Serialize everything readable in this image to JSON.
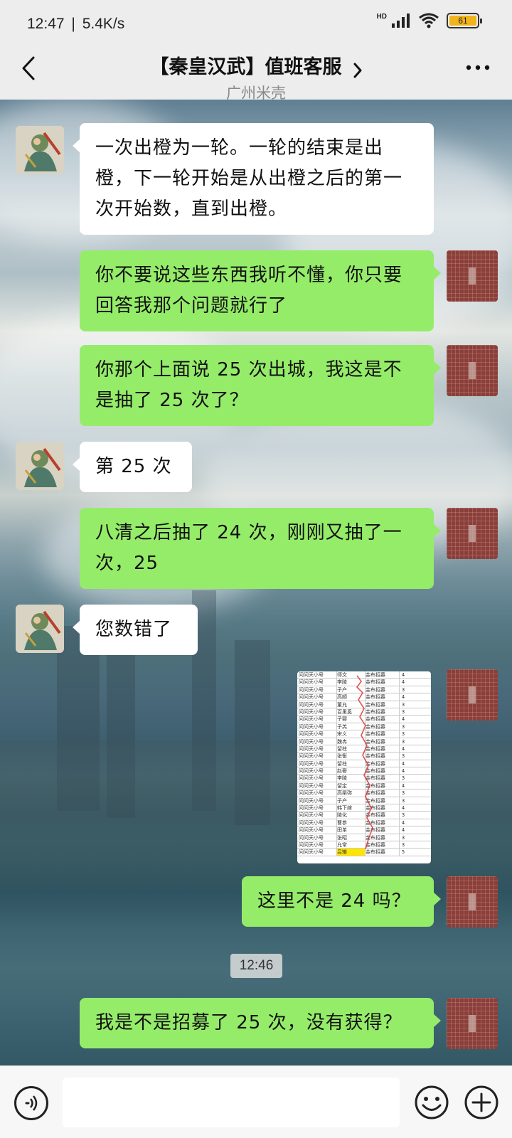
{
  "status_bar": {
    "time": "12:47",
    "speed": "5.4K/s",
    "hd_label": "HD",
    "battery": "61"
  },
  "header": {
    "title": "【秦皇汉武】值班客服",
    "subtitle": "广州米壳",
    "back_icon": "chevron-left-icon",
    "more_icon": "more-dots-icon"
  },
  "messages": [
    {
      "side": "left",
      "text": "一次出橙为一轮。一轮的结束是出橙，下一轮开始是从出橙之后的第一次开始数，直到出橙。"
    },
    {
      "side": "right",
      "text": "你不要说这些东西我听不懂，你只要回答我那个问题就行了"
    },
    {
      "side": "right",
      "text": "你那个上面说 25 次出城，我这是不是抽了 25 次了？"
    },
    {
      "side": "left",
      "text": "第 25 次"
    },
    {
      "side": "right",
      "text": "八清之后抽了 24 次，刚刚又抽了一次，25"
    },
    {
      "side": "left",
      "text": "您数错了"
    },
    {
      "side": "right",
      "type": "image",
      "alt": "recruit-log-screenshot"
    },
    {
      "side": "right",
      "text": "这里不是 24 吗？"
    },
    {
      "side": "right",
      "text": "我是不是招募了 25 次，没有获得？"
    }
  ],
  "timestamp_chip": "12:46",
  "image_table": {
    "rows": [
      [
        "问问天小号",
        "师文",
        "金布招募",
        "4"
      ],
      [
        "问问天小号",
        "李陵",
        "金布招募",
        "4"
      ],
      [
        "问问天小号",
        "子产",
        "金布招募",
        "3"
      ],
      [
        "问问天小号",
        "高顺",
        "金布招募",
        "4"
      ],
      [
        "问问天小号",
        "董允",
        "金布招募",
        "3"
      ],
      [
        "问问天小号",
        "百里奚",
        "金布招募",
        "3"
      ],
      [
        "问问天小号",
        "子婴",
        "金布招募",
        "4"
      ],
      [
        "问问天小号",
        "子羔",
        "金布招募",
        "3"
      ],
      [
        "问问天小号",
        "宋义",
        "金布招募",
        "3"
      ],
      [
        "问问天小号",
        "魏冉",
        "金布招募",
        "3"
      ],
      [
        "问问天小号",
        "留柱",
        "金布招募",
        "4"
      ],
      [
        "问问天小号",
        "张衡",
        "金布招募",
        "3"
      ],
      [
        "问问天小号",
        "留柱",
        "金布招募",
        "4"
      ],
      [
        "问问天小号",
        "赵奢",
        "金布招募",
        "4"
      ],
      [
        "问问天小号",
        "李陵",
        "金布招募",
        "3"
      ],
      [
        "问问天小号",
        "留定",
        "金布招募",
        "4"
      ],
      [
        "问问天小号",
        "高渠弥",
        "金布招募",
        "3"
      ],
      [
        "问问天小号",
        "子产",
        "金布招募",
        "3"
      ],
      [
        "问问天小号",
        "韩下嫁",
        "金布招募",
        "4"
      ],
      [
        "问问天小号",
        "陵化",
        "金布招募",
        "3"
      ],
      [
        "问问天小号",
        "曹参",
        "金布招募",
        "4"
      ],
      [
        "问问天小号",
        "田单",
        "金布招募",
        "4"
      ],
      [
        "问问天小号",
        "张昭",
        "金布招募",
        "3"
      ],
      [
        "问问天小号",
        "允常",
        "金布招募",
        "3"
      ],
      [
        "问问天小号",
        "吕雉",
        "金布招募",
        "5"
      ]
    ]
  },
  "input_bar": {
    "voice_icon": "voice-icon",
    "placeholder": "",
    "emoji_icon": "emoji-icon",
    "plus_icon": "plus-icon"
  }
}
